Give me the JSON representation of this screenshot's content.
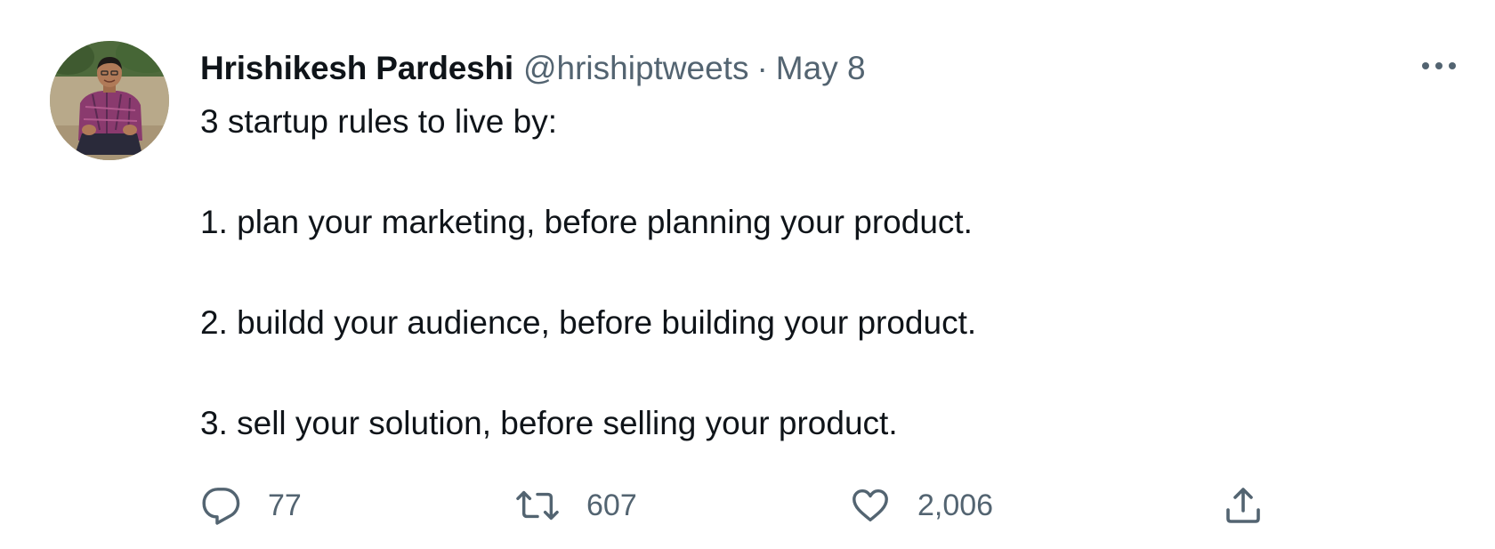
{
  "tweet": {
    "author": {
      "display_name": "Hrishikesh Pardeshi",
      "handle": "@hrishiptweets"
    },
    "separator": "·",
    "date": "May 8",
    "text": {
      "intro": "3 startup rules to live by:",
      "rules": [
        "1. plan your marketing, before planning your product.",
        "2. buildd your audience, before building your product.",
        "3. sell your solution, before selling your product."
      ]
    },
    "actions": {
      "reply": {
        "icon": "reply-icon",
        "count": "77"
      },
      "retweet": {
        "icon": "retweet-icon",
        "count": "607"
      },
      "like": {
        "icon": "heart-icon",
        "count": "2,006"
      },
      "share": {
        "icon": "share-icon"
      }
    },
    "more_icon": "more-icon"
  },
  "colors": {
    "primary_text": "#0f1419",
    "secondary_text": "#536471",
    "background": "#ffffff"
  }
}
